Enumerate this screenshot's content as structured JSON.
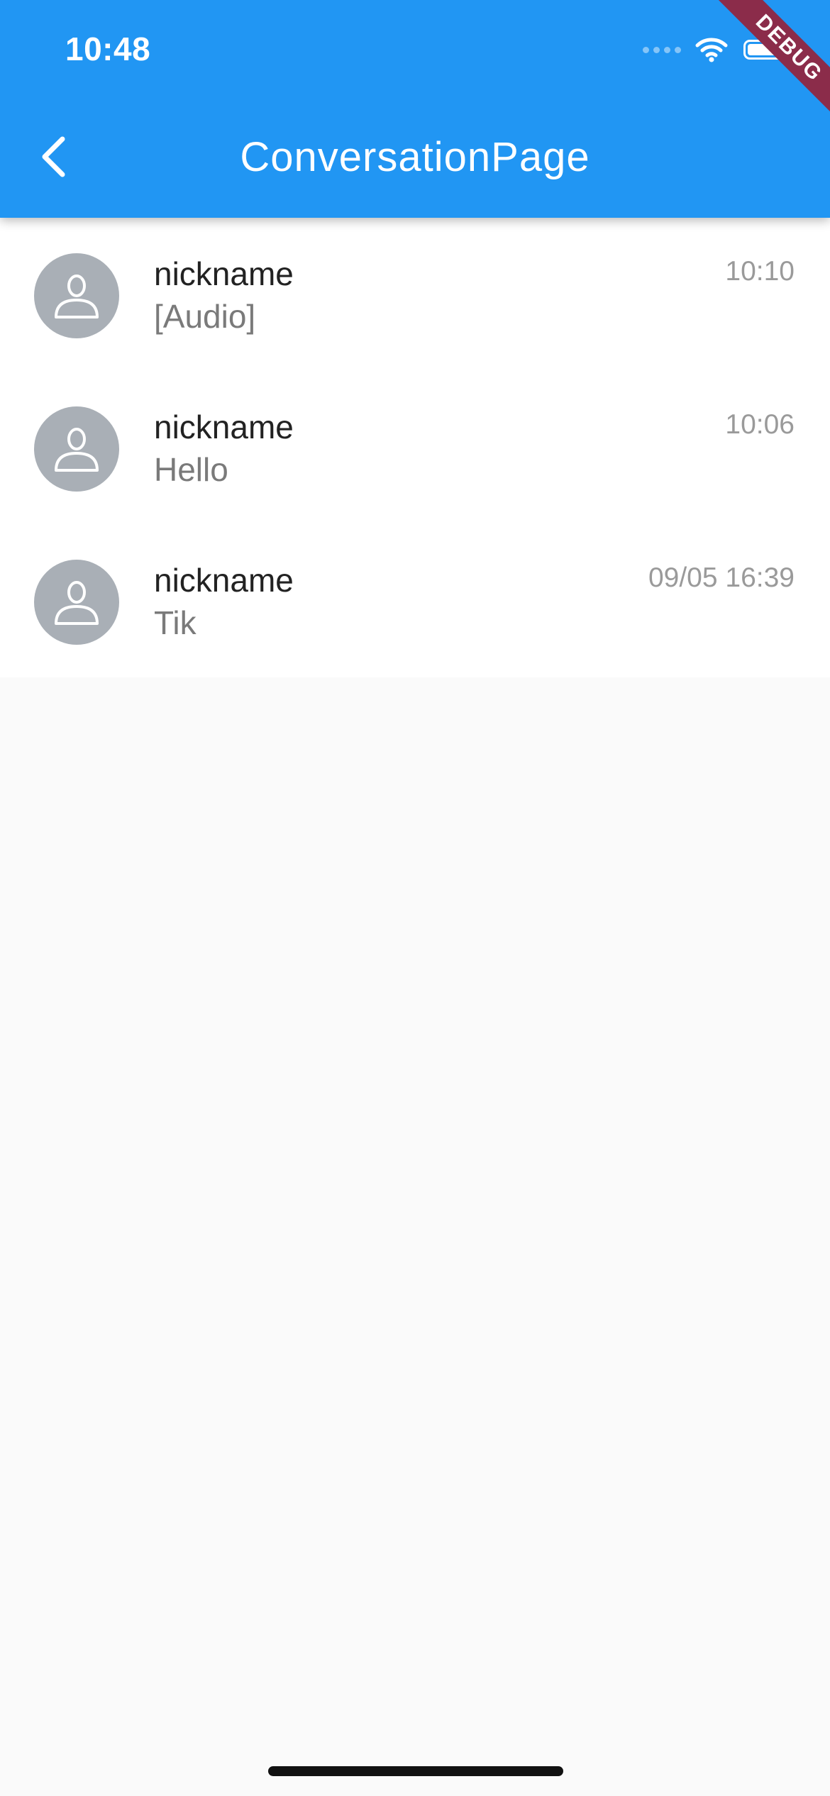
{
  "status_bar": {
    "time": "10:48"
  },
  "app_bar": {
    "title": "ConversationPage",
    "back_icon": "chevron-left-icon",
    "background": "#2196f3"
  },
  "debug_banner": "DEBUG",
  "conversations": [
    {
      "nickname": "nickname",
      "preview": "[Audio]",
      "time": "10:10",
      "avatar_icon": "person-icon"
    },
    {
      "nickname": "nickname",
      "preview": "Hello",
      "time": "10:06",
      "avatar_icon": "person-icon"
    },
    {
      "nickname": "nickname",
      "preview": "Tik",
      "time": "09/05 16:39",
      "avatar_icon": "person-icon"
    }
  ],
  "colors": {
    "accent": "#2196f3",
    "avatar_bg": "#a9afb6",
    "page_bg": "#fafafa",
    "debug_ribbon": "#8b2c4a"
  }
}
